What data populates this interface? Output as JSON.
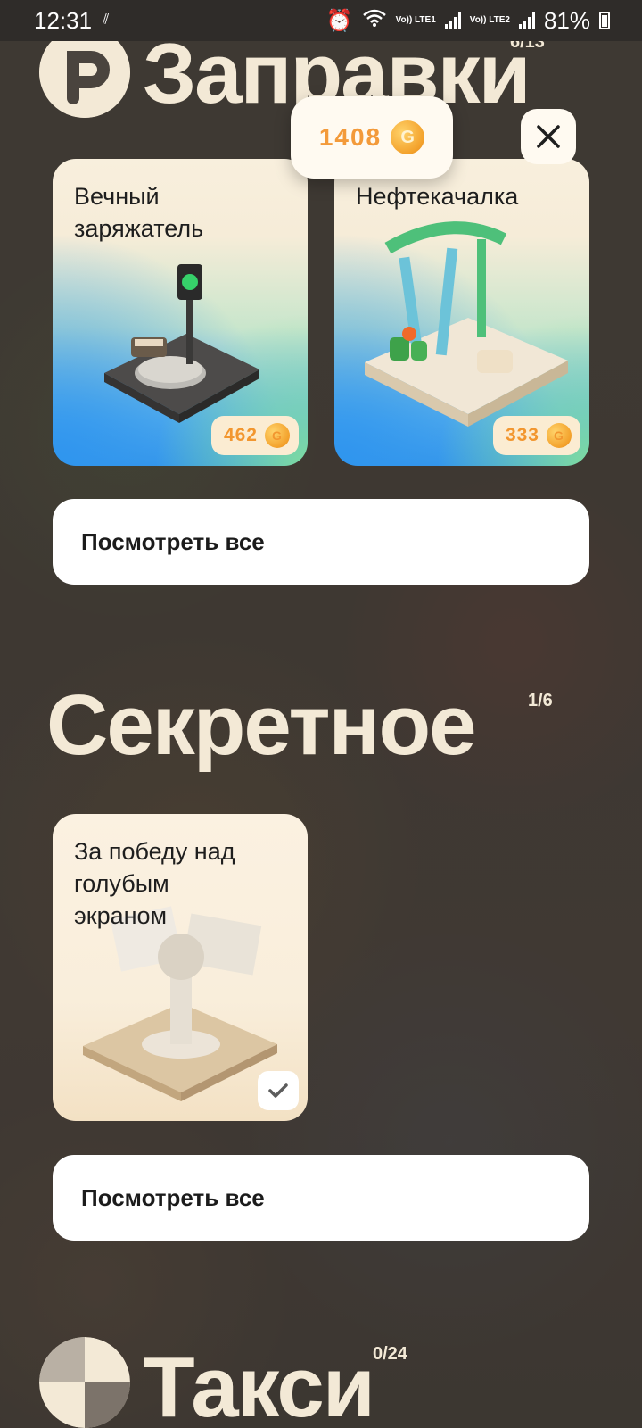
{
  "status_bar": {
    "time": "12:31",
    "network1": "Vo)) LTE1",
    "network2": "Vo)) LTE2",
    "battery": "81%"
  },
  "header_gas": {
    "title": "Заправки",
    "counter": "6/13"
  },
  "coins": {
    "value": "1408",
    "coin_symbol": "G"
  },
  "cards_gas": [
    {
      "title": "Вечный заряжатель",
      "price": "462"
    },
    {
      "title": "Нефтекачалка",
      "price": "333"
    }
  ],
  "see_all_label": "Посмотреть все",
  "header_secret": {
    "title": "Секретное",
    "counter": "1/6"
  },
  "cards_secret": [
    {
      "title": "За победу над голубым экраном"
    }
  ],
  "header_taxi": {
    "title": "Такси",
    "counter": "0/24"
  },
  "colors": {
    "accent_orange": "#f39a3a",
    "cream": "#f3e9d6"
  }
}
